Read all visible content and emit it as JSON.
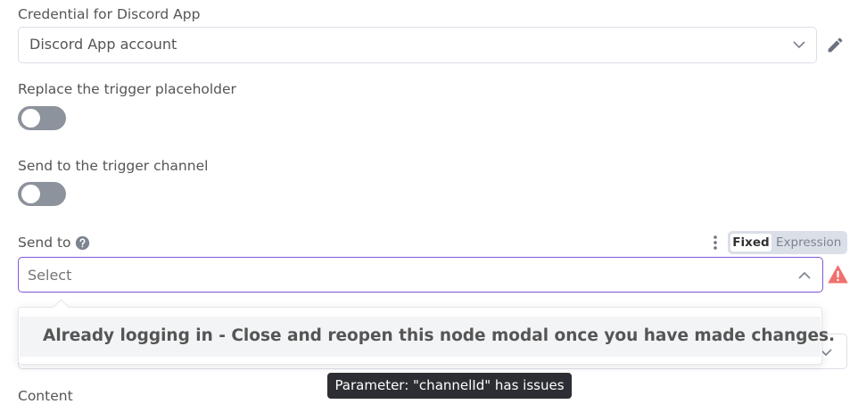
{
  "credential": {
    "label": "Credential for Discord App",
    "selected": "Discord App account",
    "icons": {
      "chevron": "chevron-down-icon",
      "edit": "pencil-icon"
    }
  },
  "replace_placeholder": {
    "label": "Replace the trigger placeholder",
    "enabled": false
  },
  "send_trigger_channel": {
    "label": "Send to the trigger channel",
    "enabled": false
  },
  "send_to": {
    "label": "Send to",
    "help_icon": "question-circle-icon",
    "options_icon": "vertical-dots-icon",
    "mode_fixed": "Fixed",
    "mode_expression": "Expression",
    "placeholder": "Select",
    "value": "",
    "warning_icon": "warning-triangle-icon",
    "accent_color": "#7f56d9",
    "warning_color": "#f0706c"
  },
  "dropdown": {
    "message": "Already logging in - Close and reopen this node modal once you have made changes."
  },
  "content": {
    "label": "Content"
  },
  "tooltip": {
    "text": "Parameter: \"channelId\" has issues"
  }
}
